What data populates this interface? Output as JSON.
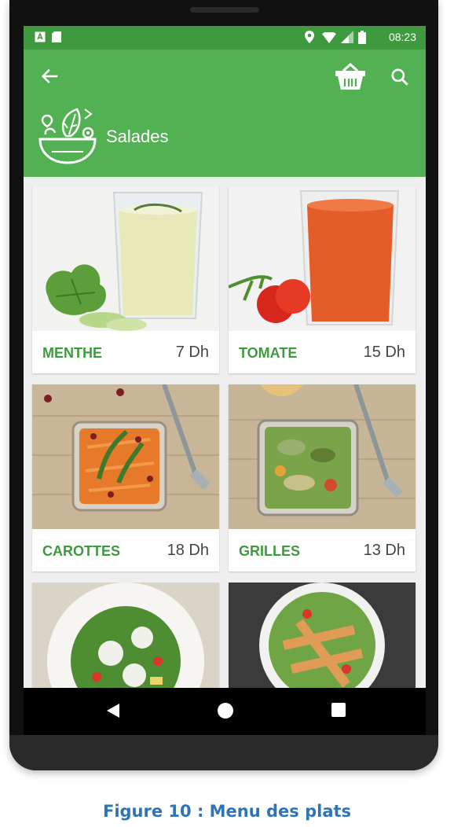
{
  "status_bar": {
    "time": "08:23"
  },
  "app_bar": {
    "category_title": "Salades"
  },
  "items": [
    {
      "name": "MENTHE",
      "price": "7 Dh"
    },
    {
      "name": "TOMATE",
      "price": "15 Dh"
    },
    {
      "name": "CAROTTES",
      "price": "18 Dh"
    },
    {
      "name": "GRILLES",
      "price": "13 Dh"
    }
  ],
  "caption": "Figure 10 : Menu des plats",
  "colors": {
    "primary": "#52b152",
    "primary_dark": "#3f9a3f",
    "caption": "#2f74b5"
  },
  "icons": {
    "back": "arrow-left-icon",
    "basket": "basket-icon",
    "search": "search-icon",
    "category": "salad-bowl-icon",
    "nav": [
      "nav-back-icon",
      "nav-home-icon",
      "nav-recents-icon"
    ]
  }
}
